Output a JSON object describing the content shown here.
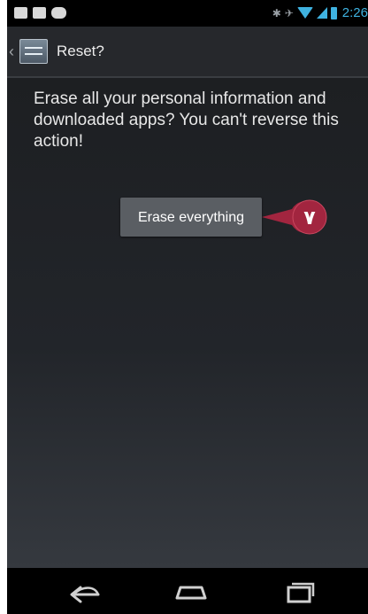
{
  "status_bar": {
    "clock": "2:26",
    "left_icons": [
      "chat-icon",
      "calendar-icon",
      "gamepad-icon"
    ],
    "right_icons": [
      "bluetooth-icon",
      "vibrate-icon",
      "wifi-icon",
      "signal-icon",
      "battery-icon"
    ],
    "accent_color": "#3fb2e0"
  },
  "action_bar": {
    "title": "Reset?",
    "icon": "settings-app-icon"
  },
  "content": {
    "message": "Erase all your personal information and downloaded apps? You can't reverse this action!",
    "erase_button_label": "Erase everything"
  },
  "callout": {
    "label": "٧",
    "color": "#a2253f"
  },
  "nav_bar": {
    "buttons": [
      "back-icon",
      "home-icon",
      "recent-apps-icon"
    ]
  }
}
